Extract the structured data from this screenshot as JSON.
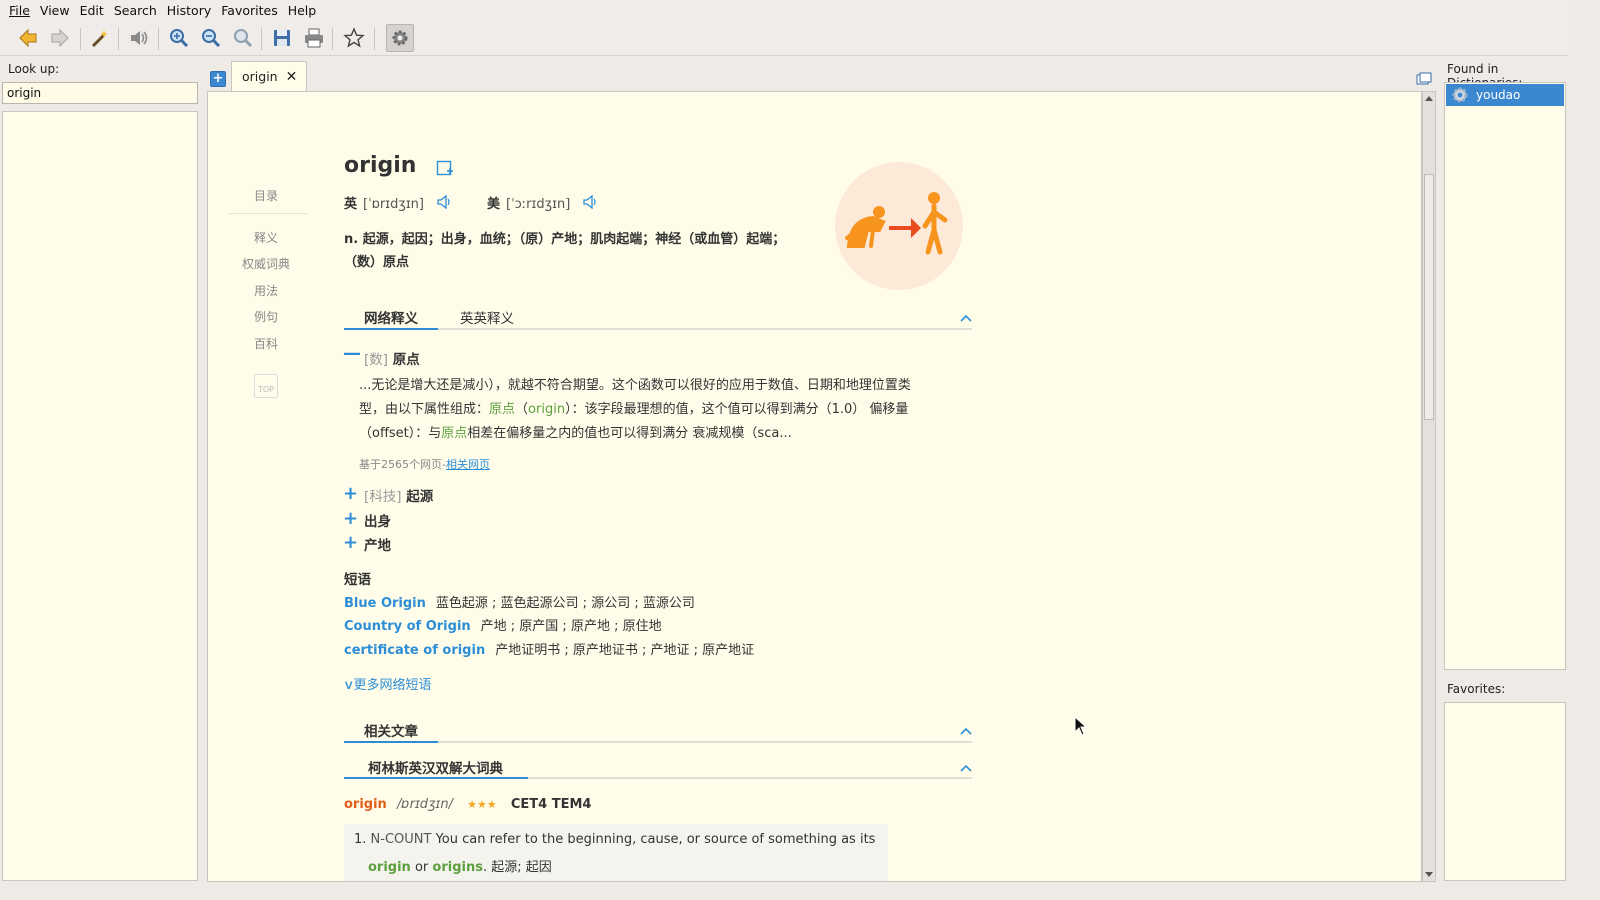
{
  "menubar": {
    "items": [
      "File",
      "View",
      "Edit",
      "Search",
      "History",
      "Favorites",
      "Help"
    ]
  },
  "toolbar": {
    "buttons": [
      "back-icon",
      "forward-icon",
      "scan-popup-icon",
      "pronounce-icon",
      "zoom-in-icon",
      "zoom-out-icon",
      "zoom-reset-icon",
      "save-icon",
      "print-icon",
      "favorite-star-icon",
      "settings-gear-icon"
    ]
  },
  "left": {
    "lookup_label": "Look up:",
    "search_value": "origin"
  },
  "tab": {
    "label": "origin",
    "close": "✕",
    "new_tab": "+"
  },
  "article": {
    "nav": [
      "目录",
      "释义",
      "权威词典",
      "用法",
      "例句",
      "百科",
      "TOP"
    ],
    "word": "origin",
    "uk_label": "英",
    "uk_phonetic": "[ˈɒrɪdʒɪn]",
    "us_label": "美",
    "us_phonetic": "[ˈɔːrɪdʒɪn]",
    "definition_line1": "n. 起源，起因；出身，血统；（原）产地；肌肉起端；神经（或血管）起端；",
    "definition_line2": "（数）原点",
    "tabs": [
      "网络释义",
      "英英释义"
    ],
    "senses": [
      {
        "marker": "—",
        "tag": "[数]",
        "word": "原点"
      },
      {
        "marker": "+",
        "tag": "[科技]",
        "word": "起源"
      },
      {
        "marker": "+",
        "tag": "",
        "word": "出身"
      },
      {
        "marker": "+",
        "tag": "",
        "word": "产地"
      }
    ],
    "para": {
      "l1": "...无论是增大还是减小），就越不符合期望。这个函数可以很好的应用于数值、日期和地理位置类",
      "l2a": "型，由以下属性组成：",
      "l2b": "原点",
      "l2c": "（",
      "l2d": "origin",
      "l2e": "）：该字段最理想的值，这个值可以得到满分（1.0） 偏移量",
      "l3a": "（offset）：与",
      "l3b": "原点",
      "l3c": "相差在偏移量之内的值也可以得到满分 衰减规模（sca..."
    },
    "source": "基于2565个网页-",
    "source_link": "相关网页",
    "phrases_title": "短语",
    "phrases": [
      {
        "en": "Blue Origin",
        "zh": "蓝色起源 ; 蓝色起源公司 ; 源公司 ; 蓝源公司"
      },
      {
        "en": "Country of Origin",
        "zh": "产地 ; 原产国 ; 原产地 ; 原住地"
      },
      {
        "en": "certificate of origin",
        "zh": "产地证明书 ; 原产地证书 ; 产地证 ; 原产地证"
      }
    ],
    "more_phrases": "更多网络短语",
    "related_articles": "相关文章",
    "collins_title": "柯林斯英汉双解大词典",
    "collins": {
      "word": "origin",
      "phonetic": "/ɒrɪdʒɪn/",
      "stars": "★★★",
      "level": "CET4 TEM4",
      "def_num": "1.",
      "def_pos": "N-COUNT",
      "def_text": "You can refer to the beginning, cause, or source of something as its",
      "word_a": "origin",
      "or": "or",
      "word_b": "origins",
      "zh": ". 起源; 起因"
    }
  },
  "right": {
    "found_label": "Found in Dictionaries:",
    "dictionaries": [
      "youdao"
    ],
    "favorites_label": "Favorites:"
  },
  "colors": {
    "accent": "#2c8ed6",
    "selection": "#3b88d1",
    "highlight": "#5ea03f",
    "collins_word": "#e35d1b",
    "illustration": "#f7941d"
  }
}
